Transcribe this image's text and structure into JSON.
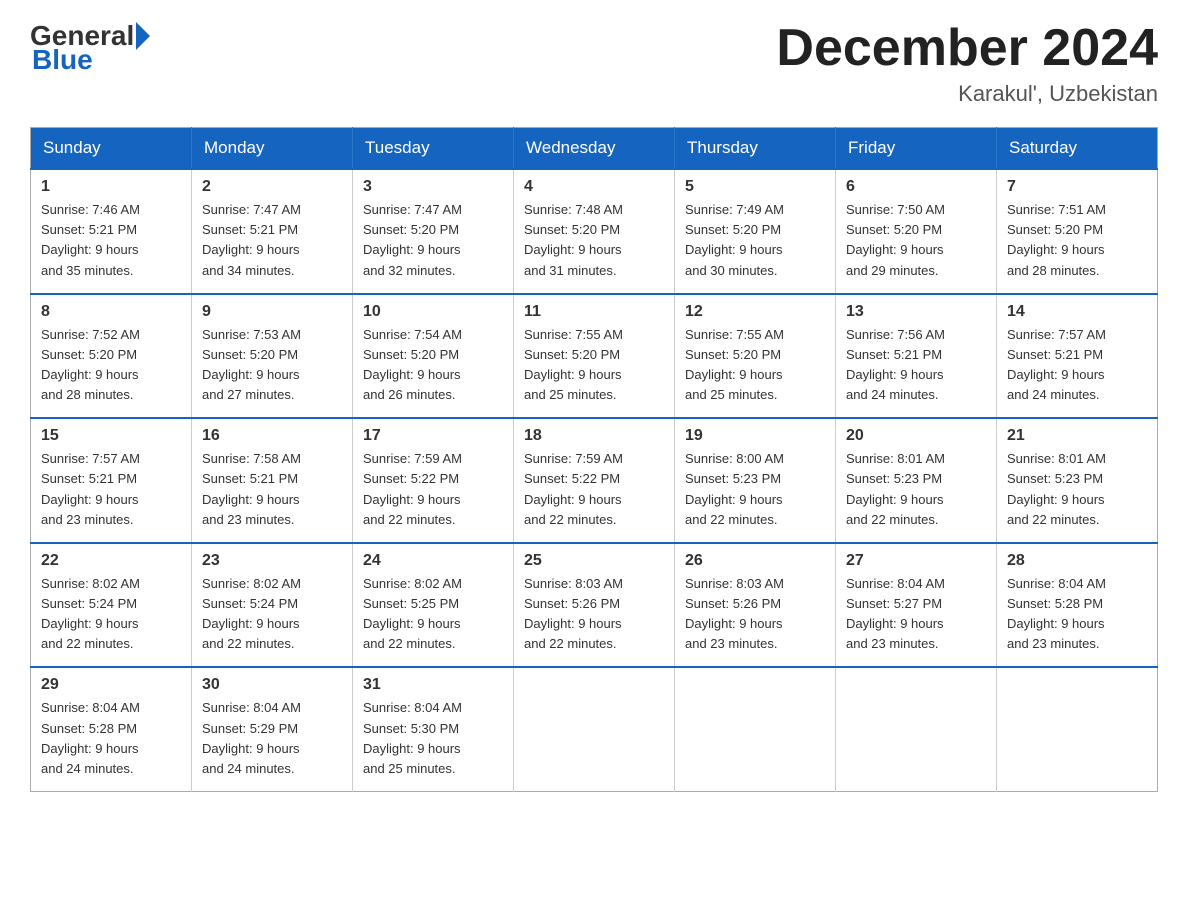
{
  "logo": {
    "general": "General",
    "blue": "Blue"
  },
  "title": "December 2024",
  "location": "Karakul', Uzbekistan",
  "days_of_week": [
    "Sunday",
    "Monday",
    "Tuesday",
    "Wednesday",
    "Thursday",
    "Friday",
    "Saturday"
  ],
  "weeks": [
    [
      {
        "day": "1",
        "sunrise": "7:46 AM",
        "sunset": "5:21 PM",
        "daylight": "9 hours and 35 minutes."
      },
      {
        "day": "2",
        "sunrise": "7:47 AM",
        "sunset": "5:21 PM",
        "daylight": "9 hours and 34 minutes."
      },
      {
        "day": "3",
        "sunrise": "7:47 AM",
        "sunset": "5:20 PM",
        "daylight": "9 hours and 32 minutes."
      },
      {
        "day": "4",
        "sunrise": "7:48 AM",
        "sunset": "5:20 PM",
        "daylight": "9 hours and 31 minutes."
      },
      {
        "day": "5",
        "sunrise": "7:49 AM",
        "sunset": "5:20 PM",
        "daylight": "9 hours and 30 minutes."
      },
      {
        "day": "6",
        "sunrise": "7:50 AM",
        "sunset": "5:20 PM",
        "daylight": "9 hours and 29 minutes."
      },
      {
        "day": "7",
        "sunrise": "7:51 AM",
        "sunset": "5:20 PM",
        "daylight": "9 hours and 28 minutes."
      }
    ],
    [
      {
        "day": "8",
        "sunrise": "7:52 AM",
        "sunset": "5:20 PM",
        "daylight": "9 hours and 28 minutes."
      },
      {
        "day": "9",
        "sunrise": "7:53 AM",
        "sunset": "5:20 PM",
        "daylight": "9 hours and 27 minutes."
      },
      {
        "day": "10",
        "sunrise": "7:54 AM",
        "sunset": "5:20 PM",
        "daylight": "9 hours and 26 minutes."
      },
      {
        "day": "11",
        "sunrise": "7:55 AM",
        "sunset": "5:20 PM",
        "daylight": "9 hours and 25 minutes."
      },
      {
        "day": "12",
        "sunrise": "7:55 AM",
        "sunset": "5:20 PM",
        "daylight": "9 hours and 25 minutes."
      },
      {
        "day": "13",
        "sunrise": "7:56 AM",
        "sunset": "5:21 PM",
        "daylight": "9 hours and 24 minutes."
      },
      {
        "day": "14",
        "sunrise": "7:57 AM",
        "sunset": "5:21 PM",
        "daylight": "9 hours and 24 minutes."
      }
    ],
    [
      {
        "day": "15",
        "sunrise": "7:57 AM",
        "sunset": "5:21 PM",
        "daylight": "9 hours and 23 minutes."
      },
      {
        "day": "16",
        "sunrise": "7:58 AM",
        "sunset": "5:21 PM",
        "daylight": "9 hours and 23 minutes."
      },
      {
        "day": "17",
        "sunrise": "7:59 AM",
        "sunset": "5:22 PM",
        "daylight": "9 hours and 22 minutes."
      },
      {
        "day": "18",
        "sunrise": "7:59 AM",
        "sunset": "5:22 PM",
        "daylight": "9 hours and 22 minutes."
      },
      {
        "day": "19",
        "sunrise": "8:00 AM",
        "sunset": "5:23 PM",
        "daylight": "9 hours and 22 minutes."
      },
      {
        "day": "20",
        "sunrise": "8:01 AM",
        "sunset": "5:23 PM",
        "daylight": "9 hours and 22 minutes."
      },
      {
        "day": "21",
        "sunrise": "8:01 AM",
        "sunset": "5:23 PM",
        "daylight": "9 hours and 22 minutes."
      }
    ],
    [
      {
        "day": "22",
        "sunrise": "8:02 AM",
        "sunset": "5:24 PM",
        "daylight": "9 hours and 22 minutes."
      },
      {
        "day": "23",
        "sunrise": "8:02 AM",
        "sunset": "5:24 PM",
        "daylight": "9 hours and 22 minutes."
      },
      {
        "day": "24",
        "sunrise": "8:02 AM",
        "sunset": "5:25 PM",
        "daylight": "9 hours and 22 minutes."
      },
      {
        "day": "25",
        "sunrise": "8:03 AM",
        "sunset": "5:26 PM",
        "daylight": "9 hours and 22 minutes."
      },
      {
        "day": "26",
        "sunrise": "8:03 AM",
        "sunset": "5:26 PM",
        "daylight": "9 hours and 23 minutes."
      },
      {
        "day": "27",
        "sunrise": "8:04 AM",
        "sunset": "5:27 PM",
        "daylight": "9 hours and 23 minutes."
      },
      {
        "day": "28",
        "sunrise": "8:04 AM",
        "sunset": "5:28 PM",
        "daylight": "9 hours and 23 minutes."
      }
    ],
    [
      {
        "day": "29",
        "sunrise": "8:04 AM",
        "sunset": "5:28 PM",
        "daylight": "9 hours and 24 minutes."
      },
      {
        "day": "30",
        "sunrise": "8:04 AM",
        "sunset": "5:29 PM",
        "daylight": "9 hours and 24 minutes."
      },
      {
        "day": "31",
        "sunrise": "8:04 AM",
        "sunset": "5:30 PM",
        "daylight": "9 hours and 25 minutes."
      },
      null,
      null,
      null,
      null
    ]
  ],
  "labels": {
    "sunrise": "Sunrise:",
    "sunset": "Sunset:",
    "daylight": "Daylight:"
  }
}
